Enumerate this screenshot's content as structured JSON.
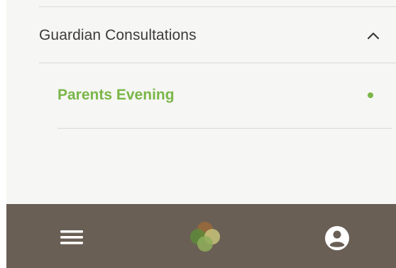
{
  "accordion": {
    "section_title": "Guardian Consultations",
    "expanded": true,
    "items": [
      {
        "label": "Parents Evening",
        "active": true
      }
    ]
  },
  "bottom_nav": {
    "icons": [
      "menu-icon",
      "app-logo-icon",
      "account-icon"
    ]
  },
  "colors": {
    "accent": "#7ab648",
    "nav_background": "#6a5f55",
    "panel_background": "#f6f6f4",
    "text": "#3c3b39"
  }
}
